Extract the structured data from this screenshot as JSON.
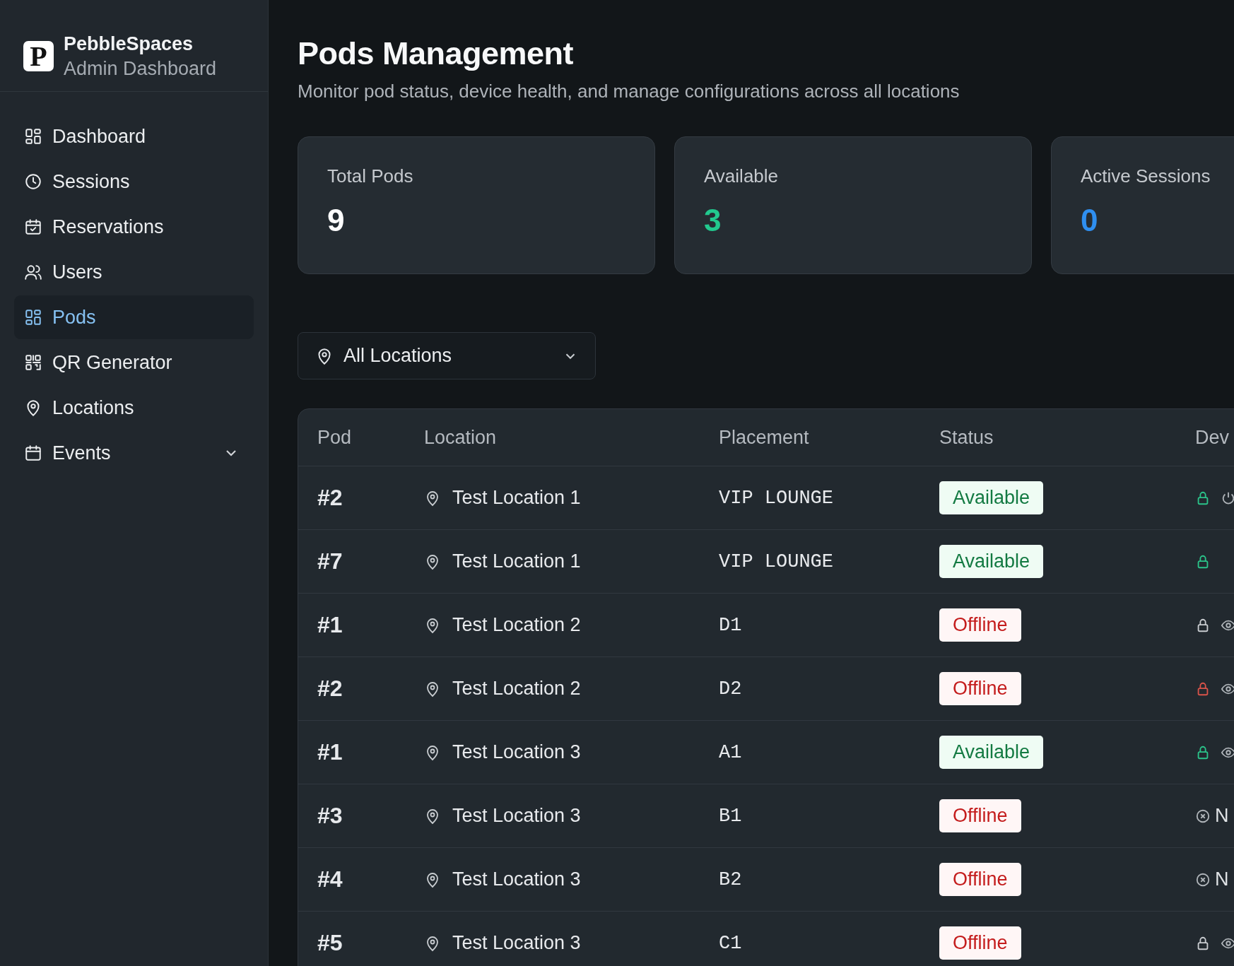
{
  "brand": {
    "logo_letter": "P",
    "name": "PebbleSpaces",
    "subtitle": "Admin Dashboard"
  },
  "nav": [
    {
      "label": "Dashboard",
      "selected": false
    },
    {
      "label": "Sessions",
      "selected": false
    },
    {
      "label": "Reservations",
      "selected": false
    },
    {
      "label": "Users",
      "selected": false
    },
    {
      "label": "Pods",
      "selected": true
    },
    {
      "label": "QR Generator",
      "selected": false
    },
    {
      "label": "Locations",
      "selected": false
    },
    {
      "label": "Events",
      "selected": false,
      "expandable": true
    }
  ],
  "header": {
    "title": "Pods Management",
    "subtitle": "Monitor pod status, device health, and manage configurations across all locations"
  },
  "stats": [
    {
      "label": "Total Pods",
      "value": "9",
      "color": "#ffffff"
    },
    {
      "label": "Available",
      "value": "3",
      "color": "#22c98e"
    },
    {
      "label": "Active Sessions",
      "value": "0",
      "color": "#2f8ff0"
    }
  ],
  "location_filter": {
    "value": "All Locations"
  },
  "table": {
    "columns": [
      "Pod",
      "Location",
      "Placement",
      "Status",
      "Dev"
    ],
    "rows": [
      {
        "pod": "#2",
        "location": "Test Location 1",
        "placement": "VIP LOUNGE",
        "status": "Available",
        "device": {
          "kind": "lock_power",
          "color": "#2bc48a"
        }
      },
      {
        "pod": "#7",
        "location": "Test Location 1",
        "placement": "VIP LOUNGE",
        "status": "Available",
        "device": {
          "kind": "lock",
          "color": "#2bc48a"
        }
      },
      {
        "pod": "#1",
        "location": "Test Location 2",
        "placement": "D1",
        "status": "Offline",
        "device": {
          "kind": "lock_eye",
          "color": "#c9ccd0"
        }
      },
      {
        "pod": "#2",
        "location": "Test Location 2",
        "placement": "D2",
        "status": "Offline",
        "device": {
          "kind": "lock_eye",
          "color": "#d9534a"
        }
      },
      {
        "pod": "#1",
        "location": "Test Location 3",
        "placement": "A1",
        "status": "Available",
        "device": {
          "kind": "lock_eye",
          "color": "#2bc48a"
        }
      },
      {
        "pod": "#3",
        "location": "Test Location 3",
        "placement": "B1",
        "status": "Offline",
        "device": {
          "kind": "none",
          "text": "N"
        }
      },
      {
        "pod": "#4",
        "location": "Test Location 3",
        "placement": "B2",
        "status": "Offline",
        "device": {
          "kind": "none",
          "text": "N"
        }
      },
      {
        "pod": "#5",
        "location": "Test Location 3",
        "placement": "C1",
        "status": "Offline",
        "device": {
          "kind": "lock_eye",
          "color": "#c9ccd0"
        }
      }
    ]
  }
}
